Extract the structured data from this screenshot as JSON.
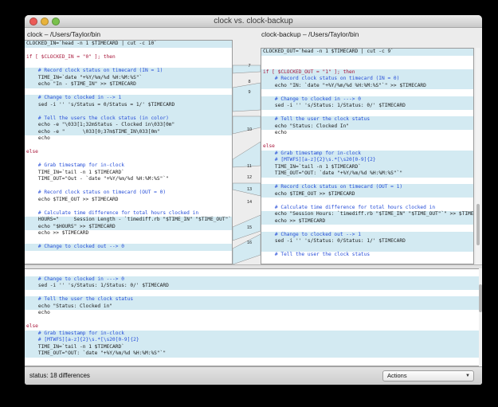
{
  "window": {
    "title": "clock vs. clock-backup"
  },
  "paths": {
    "left": "clock – /Users/Taylor/bin",
    "right": "clock-backup – /Users/Taylor/bin"
  },
  "left_lines": [
    {
      "t": "CLOCKED_IN=`head -n 1 $TIMECARD | cut -c 10`",
      "d": true
    },
    {
      "t": "",
      "d": false
    },
    {
      "t": "if [ $CLOCKED_IN = \"0\" ]; then",
      "d": false,
      "k": true
    },
    {
      "t": "",
      "d": false
    },
    {
      "t": "    # Record clock status on timecard (IN = 1)",
      "d": true,
      "c": true
    },
    {
      "t": "    TIME_IN=`date \"+%Y/%m/%d %H:%M:%S\"`",
      "d": true
    },
    {
      "t": "    echo \"In - $TIME_IN\" >> $TIMECARD",
      "d": true
    },
    {
      "t": "",
      "d": false
    },
    {
      "t": "    # Change to clocked in --> 1",
      "d": true,
      "c": true
    },
    {
      "t": "    sed -i '' 's/Status = 0/Status = 1/' $TIMECARD",
      "d": true
    },
    {
      "t": "",
      "d": true
    },
    {
      "t": "    # Tell the users the clock status (in color)",
      "d": true,
      "c": true
    },
    {
      "t": "    echo -e \"\\033[1;32mStatus - Clocked in\\033[0m\"",
      "d": true
    },
    {
      "t": "    echo -e \"      \\033[0;37m$TIME_IN\\033[0m\"",
      "d": true
    },
    {
      "t": "    echo",
      "d": false
    },
    {
      "t": "",
      "d": false
    },
    {
      "t": "else",
      "d": false,
      "k": true
    },
    {
      "t": "",
      "d": false
    },
    {
      "t": "    # Grab timestamp for in-clock",
      "d": false,
      "c": true
    },
    {
      "t": "    TIME_IN=`tail -n 1 $TIMECARD`",
      "d": false
    },
    {
      "t": "    TIME_OUT=\"Out - `date \"+%Y/%m/%d %H:%M:%S\"`\"",
      "d": false
    },
    {
      "t": "",
      "d": false
    },
    {
      "t": "    # Record clock status on timecard (OUT = 0)",
      "d": false,
      "c": true
    },
    {
      "t": "    echo $TIME_OUT >> $TIMECARD",
      "d": false
    },
    {
      "t": "",
      "d": false
    },
    {
      "t": "    # Calculate time difference for total hours clocked in",
      "d": false,
      "c": true
    },
    {
      "t": "    HOURS=\"     Session Length - `timediff.rb \"$TIME_IN\" \"$TIME_OUT\"`\"",
      "d": true
    },
    {
      "t": "    echo \"$HOURS\" >> $TIMECARD",
      "d": true
    },
    {
      "t": "    echo >> $TIMECARD",
      "d": false
    },
    {
      "t": "",
      "d": false
    },
    {
      "t": "    # Change to clocked out --> 0",
      "d": true,
      "c": true
    }
  ],
  "right_lines": [
    {
      "t": "CLOCKED_OUT=`head -n 1 $TIMECARD | cut -c 9`",
      "d": true
    },
    {
      "t": "",
      "d": false
    },
    {
      "t": "",
      "d": false
    },
    {
      "t": "if [ $CLOCKED_OUT = \"1\" ]; then",
      "d": true,
      "k": true
    },
    {
      "t": "    # Record clock status on timecard (IN = 0)",
      "d": true,
      "c": true
    },
    {
      "t": "    echo \"IN: `date \"+%Y/%m/%d %H:%M:%S\"`\" >> $TIMECARD",
      "d": true
    },
    {
      "t": "",
      "d": false
    },
    {
      "t": "    # Change to clocked in ---> 0",
      "d": true,
      "c": true
    },
    {
      "t": "    sed -i '' 's/Status: 1/Status: 0/' $TIMECARD",
      "d": true
    },
    {
      "t": "",
      "d": false
    },
    {
      "t": "    # Tell the user the clock status",
      "d": true,
      "c": true
    },
    {
      "t": "    echo \"Status: Clocked In\"",
      "d": true
    },
    {
      "t": "    echo",
      "d": false
    },
    {
      "t": "",
      "d": false
    },
    {
      "t": "else",
      "d": false,
      "k": true
    },
    {
      "t": "    # Grab timestamp for in-clock",
      "d": true,
      "c": true
    },
    {
      "t": "    # [MTWFS][a-z]{2}\\s.*[\\s20[0-9]{2}",
      "d": true,
      "c": true
    },
    {
      "t": "    TIME_IN=`tail -n 1 $TIMECARD`",
      "d": true
    },
    {
      "t": "    TIME_OUT=\"OUT: `date \"+%Y/%m/%d %H:%M:%S\"`\"",
      "d": true
    },
    {
      "t": "",
      "d": false
    },
    {
      "t": "    # Record clock status on timecard (OUT = 1)",
      "d": true,
      "c": true
    },
    {
      "t": "    echo $TIME_OUT >> $TIMECARD",
      "d": true
    },
    {
      "t": "",
      "d": false
    },
    {
      "t": "    # Calculate time difference for total hours clocked in",
      "d": false,
      "c": true
    },
    {
      "t": "    echo \"Session Hours: `timediff.rb \"$TIME_IN\" \"$TIME_OUT\"`\" >> $TIMECARD",
      "d": true
    },
    {
      "t": "    echo >> $TIMECARD",
      "d": true
    },
    {
      "t": "",
      "d": false
    },
    {
      "t": "    # Change to clocked out --> 1",
      "d": true,
      "c": true
    },
    {
      "t": "    sed -i '' 's/Status: 0/Status: 1/' $TIMECARD",
      "d": true
    },
    {
      "t": "",
      "d": true
    },
    {
      "t": "    # Tell the user the clock status",
      "d": false,
      "c": true
    }
  ],
  "bottom_lines": [
    {
      "t": "",
      "d": false
    },
    {
      "t": "    # Change to clocked in ---> 0",
      "d": true,
      "c": true
    },
    {
      "t": "    sed -i '' 's/Status: 1/Status: 0/' $TIMECARD",
      "d": true
    },
    {
      "t": "",
      "d": false
    },
    {
      "t": "    # Tell the user the clock status",
      "d": true,
      "c": true
    },
    {
      "t": "    echo \"Status: Clocked in\"",
      "d": true
    },
    {
      "t": "    echo",
      "d": false
    },
    {
      "t": "",
      "d": false
    },
    {
      "t": "else",
      "d": false,
      "k": true
    },
    {
      "t": "    # Grab timestamp for in-clock",
      "d": true,
      "c": true
    },
    {
      "t": "    # [MTWFS][a-z]{2}\\s.*[\\s20[0-9]{2}",
      "d": true,
      "c": true
    },
    {
      "t": "    TIME_IN=`tail -n 1 $TIMECARD`",
      "d": true
    },
    {
      "t": "    TIME_OUT=\"OUT: `date \"+%Y/%m/%d %H:%M:%S\"`\"",
      "d": true
    },
    {
      "t": "",
      "d": false
    }
  ],
  "markers": [
    "7",
    "8",
    "9",
    "10",
    "11",
    "12",
    "13",
    "14",
    "15",
    "16"
  ],
  "status": {
    "text": "status: 18 differences"
  },
  "actions": {
    "label": "Actions"
  },
  "colors": {
    "diff_highlight": "#d3eaf2",
    "comment": "#264ed8",
    "keyword": "#a8163a"
  }
}
